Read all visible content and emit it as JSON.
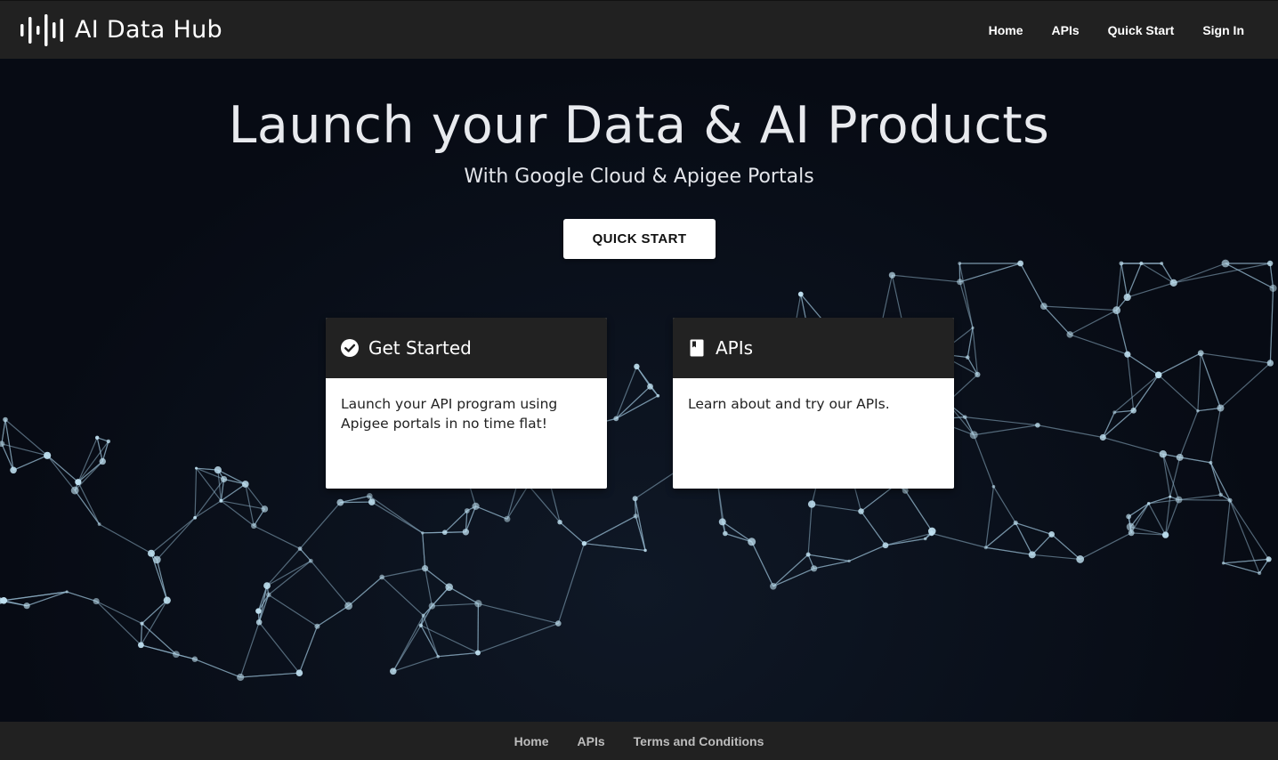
{
  "header": {
    "brand_name": "AI Data Hub",
    "brand_icon": "sound-wave-logo",
    "nav": [
      {
        "label": "Home"
      },
      {
        "label": "APIs"
      },
      {
        "label": "Quick Start"
      },
      {
        "label": "Sign In"
      }
    ]
  },
  "hero": {
    "title": "Launch your Data & AI Products",
    "subtitle": "With Google Cloud & Apigee Portals",
    "cta_label": "QUICK START"
  },
  "cards": [
    {
      "icon": "check-circle-icon",
      "title": "Get Started",
      "body": "Launch your API program using Apigee portals in no time flat!"
    },
    {
      "icon": "book-icon",
      "title": "APIs",
      "body": "Learn about and try our APIs."
    }
  ],
  "footer": {
    "links": [
      {
        "label": "Home"
      },
      {
        "label": "APIs"
      },
      {
        "label": "Terms and Conditions"
      }
    ]
  },
  "colors": {
    "header_bg": "#212121",
    "hero_bg": "#070b14",
    "card_head_bg": "#222222",
    "network_line": "#8fb3c9"
  }
}
